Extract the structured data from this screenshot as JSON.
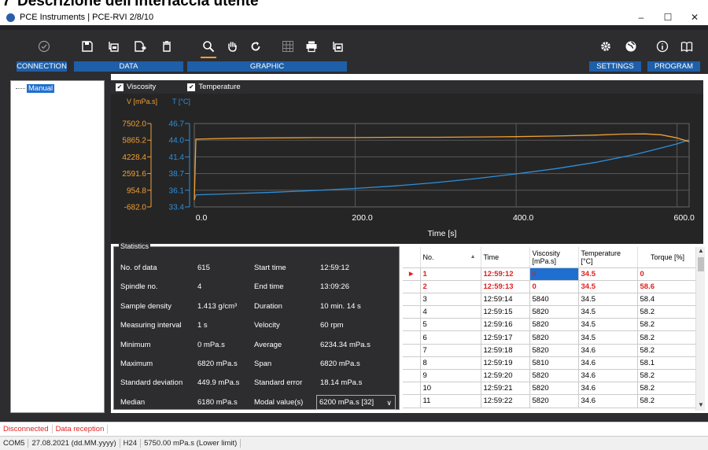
{
  "doc_header": {
    "number": "7",
    "text": "Descrizione dell'interfaccia utente"
  },
  "window": {
    "title": "PCE Instruments | PCE-RVI 2/8/10",
    "minimize": "–",
    "maximize": "☐",
    "close": "✕"
  },
  "toolbar": {
    "groups": [
      {
        "label": "CONNECTION"
      },
      {
        "label": "DATA"
      },
      {
        "label": "GRAPHIC"
      },
      {
        "label": "SETTINGS"
      },
      {
        "label": "PROGRAM"
      }
    ],
    "icons": [
      "connect-icon",
      "save-icon",
      "export-icon",
      "export-file-icon",
      "delete-icon",
      "zoom-icon",
      "pan-hand-icon",
      "reset-icon",
      "grid-icon",
      "print-icon",
      "export-image-icon",
      "gear-icon",
      "globe-icon",
      "info-icon",
      "manual-book-icon"
    ],
    "accent": "#1e5fa8",
    "active_color": "#f0a030"
  },
  "tree": {
    "root_label": "Manual"
  },
  "chart_toggles": {
    "viscosity": "Viscosity",
    "temperature": "Temperature"
  },
  "chart_data": {
    "type": "line",
    "xlabel": "Time [s]",
    "y1_label": "V [mPa.s]",
    "y2_label": "T [°C]",
    "x_ticks": [
      "0.0",
      "200.0",
      "400.0",
      "600.0"
    ],
    "xlim": [
      0,
      615
    ],
    "y1_ticks": [
      "7502.0",
      "5865.2",
      "4228.4",
      "2591.6",
      "954.8",
      "-682.0"
    ],
    "y1lim": [
      -682.0,
      7502.0
    ],
    "y2_ticks": [
      "46.7",
      "44.0",
      "41.4",
      "38.7",
      "36.1",
      "33.4"
    ],
    "y2lim": [
      33.4,
      46.7
    ],
    "grid": true,
    "series": [
      {
        "name": "Viscosity",
        "color": "#2f8fd8",
        "axis": "y1",
        "x": [
          0,
          2,
          50,
          100,
          150,
          200,
          250,
          300,
          350,
          400,
          450,
          500,
          550,
          580,
          600,
          615
        ],
        "y": [
          0,
          500,
          620,
          760,
          930,
          1130,
          1380,
          1700,
          2100,
          2560,
          3080,
          3700,
          4500,
          5100,
          5500,
          5900
        ]
      },
      {
        "name": "Temperature",
        "color": "#f0a030",
        "axis": "y2",
        "x": [
          0,
          2,
          50,
          100,
          150,
          200,
          250,
          300,
          350,
          400,
          450,
          500,
          530,
          560,
          580,
          600,
          615
        ],
        "y": [
          34.5,
          44.2,
          44.35,
          44.4,
          44.45,
          44.45,
          44.5,
          44.5,
          44.55,
          44.6,
          44.7,
          44.85,
          45.0,
          45.05,
          44.9,
          44.4,
          43.8
        ]
      }
    ]
  },
  "statistics": {
    "title": "Statistics",
    "rows": [
      {
        "label1": "No. of data",
        "value1": "615",
        "label2": "Start time",
        "value2": "12:59:12"
      },
      {
        "label1": "Spindle no.",
        "value1": "4",
        "label2": "End time",
        "value2": "13:09:26"
      },
      {
        "label1": "Sample density",
        "value1": "1.413 g/cm³",
        "label2": "Duration",
        "value2": "10 min. 14 s"
      },
      {
        "label1": "Measuring interval",
        "value1": "1 s",
        "label2": "Velocity",
        "value2": "60 rpm"
      },
      {
        "label1": "Minimum",
        "value1": "0 mPa.s",
        "label2": "Average",
        "value2": "6234.34 mPa.s"
      },
      {
        "label1": "Maximum",
        "value1": "6820 mPa.s",
        "label2": "Span",
        "value2": "6820 mPa.s"
      },
      {
        "label1": "Standard deviation",
        "value1": "449.9 mPa.s",
        "label2": "Standard error",
        "value2": "18.14 mPa.s"
      },
      {
        "label1": "Median",
        "value1": "6180 mPa.s",
        "label2": "Modal value(s)",
        "value2": "6200 mPa.s [32]"
      }
    ]
  },
  "table": {
    "headers": [
      "No.",
      "Time",
      "Viscosity\n[mPa.s]",
      "Temperature\n[°C]",
      "Torque [%]"
    ],
    "rows": [
      [
        "1",
        "12:59:12",
        "0",
        "34.5",
        "0"
      ],
      [
        "2",
        "12:59:13",
        "0",
        "34.5",
        "58.6"
      ],
      [
        "3",
        "12:59:14",
        "5840",
        "34.5",
        "58.4"
      ],
      [
        "4",
        "12:59:15",
        "5820",
        "34.5",
        "58.2"
      ],
      [
        "5",
        "12:59:16",
        "5820",
        "34.5",
        "58.2"
      ],
      [
        "6",
        "12:59:17",
        "5820",
        "34.5",
        "58.2"
      ],
      [
        "7",
        "12:59:18",
        "5820",
        "34.6",
        "58.2"
      ],
      [
        "8",
        "12:59:19",
        "5810",
        "34.6",
        "58.1"
      ],
      [
        "9",
        "12:59:20",
        "5820",
        "34.6",
        "58.2"
      ],
      [
        "10",
        "12:59:21",
        "5820",
        "34.6",
        "58.2"
      ],
      [
        "11",
        "12:59:22",
        "5820",
        "34.6",
        "58.2"
      ]
    ]
  },
  "status": {
    "connection": "Disconnected",
    "reception": "Data reception",
    "port": "COM5",
    "date": "27.08.2021 (dd.MM.yyyy)",
    "spindle": "H24",
    "limit": "5750.00 mPa.s (Lower limit)"
  }
}
